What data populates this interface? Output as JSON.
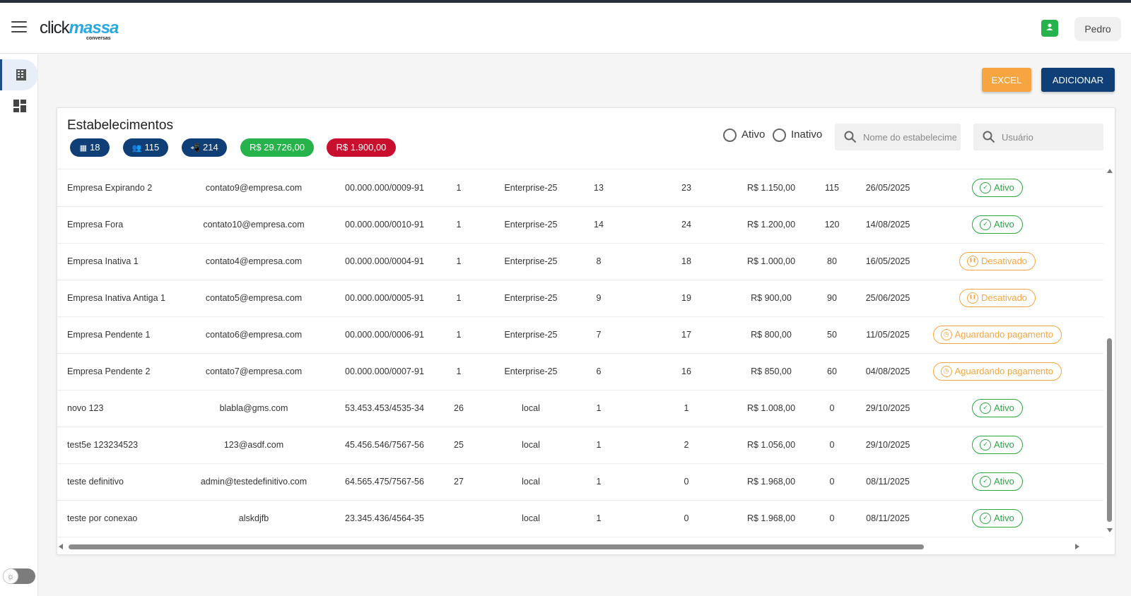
{
  "app": {
    "logo_click": "click",
    "logo_massa": "massa",
    "logo_sub": "conversas",
    "user_label": "Pedro"
  },
  "toolbar": {
    "excel_label": "EXCEL",
    "add_label": "ADICIONAR"
  },
  "card": {
    "title": "Estabelecimentos",
    "chips": [
      {
        "icon": "building-icon",
        "value": "18",
        "color": "#0f3f76"
      },
      {
        "icon": "users-icon",
        "value": "115",
        "color": "#0f3f76"
      },
      {
        "icon": "device-icon",
        "value": "214",
        "color": "#0f3f76"
      },
      {
        "icon": "money",
        "value": "R$ 29.726,00",
        "color": "#27b34b"
      },
      {
        "icon": "money",
        "value": "R$ 1.900,00",
        "color": "#c8102e"
      }
    ],
    "filters": {
      "ativo_label": "Ativo",
      "inativo_label": "Inativo"
    },
    "search": {
      "establishment_placeholder": "Nome do estabelecimento",
      "user_placeholder": "Usuário"
    }
  },
  "rows": [
    {
      "name": "Empresa Expirando 2",
      "email": "contato9@empresa.com",
      "cnpj": "00.000.000/0009-91",
      "col4": "1",
      "plan": "Enterprise-25",
      "col6": "13",
      "col7": "23",
      "value": "R$ 1.150,00",
      "col9": "115",
      "date": "26/05/2025",
      "status": "Ativo",
      "status_type": "ativo"
    },
    {
      "name": "Empresa Fora",
      "email": "contato10@empresa.com",
      "cnpj": "00.000.000/0010-91",
      "col4": "1",
      "plan": "Enterprise-25",
      "col6": "14",
      "col7": "24",
      "value": "R$ 1.200,00",
      "col9": "120",
      "date": "14/08/2025",
      "status": "Ativo",
      "status_type": "ativo"
    },
    {
      "name": "Empresa Inativa 1",
      "email": "contato4@empresa.com",
      "cnpj": "00.000.000/0004-91",
      "col4": "1",
      "plan": "Enterprise-25",
      "col6": "8",
      "col7": "18",
      "value": "R$ 1.000,00",
      "col9": "80",
      "date": "16/05/2025",
      "status": "Desativado",
      "status_type": "desativado"
    },
    {
      "name": "Empresa Inativa Antiga 1",
      "email": "contato5@empresa.com",
      "cnpj": "00.000.000/0005-91",
      "col4": "1",
      "plan": "Enterprise-25",
      "col6": "9",
      "col7": "19",
      "value": "R$ 900,00",
      "col9": "90",
      "date": "25/06/2025",
      "status": "Desativado",
      "status_type": "desativado"
    },
    {
      "name": "Empresa Pendente 1",
      "email": "contato6@empresa.com",
      "cnpj": "00.000.000/0006-91",
      "col4": "1",
      "plan": "Enterprise-25",
      "col6": "7",
      "col7": "17",
      "value": "R$ 800,00",
      "col9": "50",
      "date": "11/05/2025",
      "status": "Aguardando pagamento",
      "status_type": "aguardando"
    },
    {
      "name": "Empresa Pendente 2",
      "email": "contato7@empresa.com",
      "cnpj": "00.000.000/0007-91",
      "col4": "1",
      "plan": "Enterprise-25",
      "col6": "6",
      "col7": "16",
      "value": "R$ 850,00",
      "col9": "60",
      "date": "04/08/2025",
      "status": "Aguardando pagamento",
      "status_type": "aguardando"
    },
    {
      "name": "novo 123",
      "email": "blabla@gms.com",
      "cnpj": "53.453.453/4535-34",
      "col4": "26",
      "plan": "local",
      "col6": "1",
      "col7": "1",
      "value": "R$ 1.008,00",
      "col9": "0",
      "date": "29/10/2025",
      "status": "Ativo",
      "status_type": "ativo"
    },
    {
      "name": "test5e 123234523",
      "email": "123@asdf.com",
      "cnpj": "45.456.546/7567-56",
      "col4": "25",
      "plan": "local",
      "col6": "1",
      "col7": "2",
      "value": "R$ 1.056,00",
      "col9": "0",
      "date": "29/10/2025",
      "status": "Ativo",
      "status_type": "ativo"
    },
    {
      "name": "teste definitivo",
      "email": "admin@testedefinitivo.com",
      "cnpj": "64.565.475/7567-56",
      "col4": "27",
      "plan": "local",
      "col6": "1",
      "col7": "0",
      "value": "R$ 1.968,00",
      "col9": "0",
      "date": "08/11/2025",
      "status": "Ativo",
      "status_type": "ativo"
    },
    {
      "name": "teste por conexao",
      "email": "alskdjfb",
      "cnpj": "23.345.436/4564-35",
      "col4": "",
      "plan": "local",
      "col6": "1",
      "col7": "0",
      "value": "R$ 1.968,00",
      "col9": "0",
      "date": "08/11/2025",
      "status": "Ativo",
      "status_type": "ativo"
    }
  ],
  "colors": {
    "primary": "#0f3f76",
    "excel": "#f7a541",
    "success": "#27b34b",
    "danger": "#c8102e",
    "warning": "#f7a541"
  }
}
